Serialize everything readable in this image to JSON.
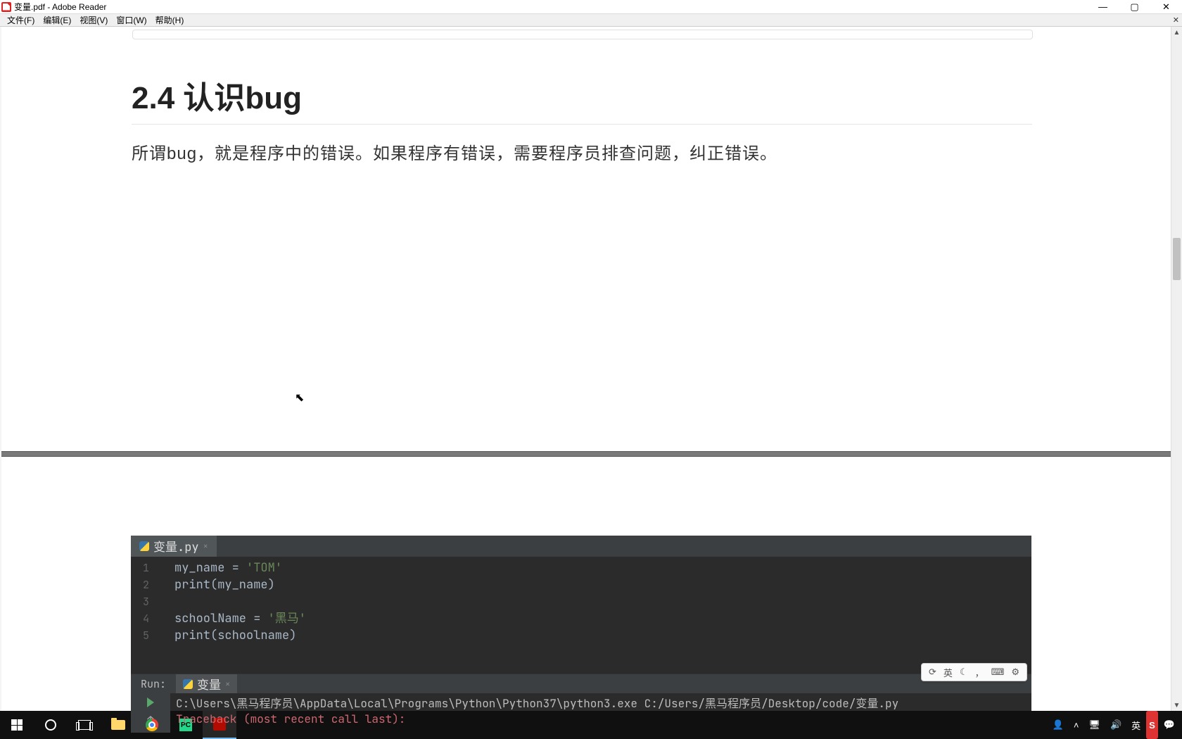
{
  "window": {
    "title": "变量.pdf - Adobe Reader"
  },
  "menu": {
    "file": "文件(F)",
    "edit": "编辑(E)",
    "view": "视图(V)",
    "window": "窗口(W)",
    "help": "帮助(H)"
  },
  "document": {
    "heading": "2.4 认识bug",
    "paragraph": "所谓bug，就是程序中的错误。如果程序有错误，需要程序员排查问题，纠正错误。"
  },
  "ide": {
    "tab_name": "变量.py",
    "gutter": [
      "1",
      "2",
      "3",
      "4",
      "5"
    ],
    "code": {
      "l1_var": "my_name",
      "l1_op": " = ",
      "l1_str": "'TOM'",
      "l2_fn": "print",
      "l2_arg": "my_name",
      "l4_var": "schoolName",
      "l4_op": " = ",
      "l4_str": "'黑马'",
      "l5_fn": "print",
      "l5_arg": "schoolname"
    },
    "run_label": "Run:",
    "run_tab": "变量",
    "console_path": "C:\\Users\\黑马程序员\\AppData\\Local\\Programs\\Python\\Python37\\python3.exe C:/Users/黑马程序员/Desktop/code/变量.py",
    "console_err": "Traceback (most recent call last):"
  },
  "ime": {
    "items": [
      "英",
      "，",
      "，"
    ]
  },
  "tray": {
    "ime_lang": "英",
    "sogou": "S"
  }
}
